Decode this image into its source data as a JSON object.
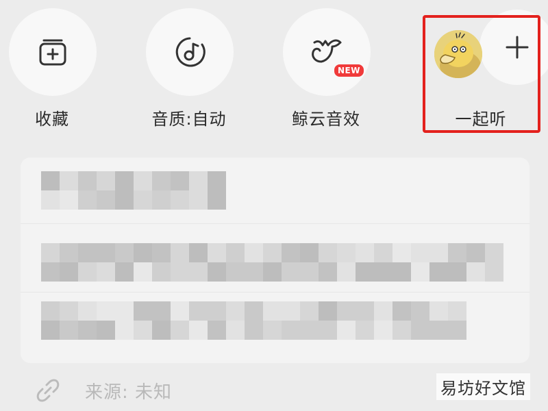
{
  "actions": {
    "collect_label": "收藏",
    "quality_label": "音质:自动",
    "effect_label": "鲸云音效",
    "effect_badge": "NEW",
    "listen_label": "一起听"
  },
  "source": {
    "label": "来源: 未知"
  },
  "watermark": "易坊好文馆",
  "colors": {
    "highlight": "#e3211d",
    "badge": "#f03a3a",
    "icon": "#333333"
  }
}
